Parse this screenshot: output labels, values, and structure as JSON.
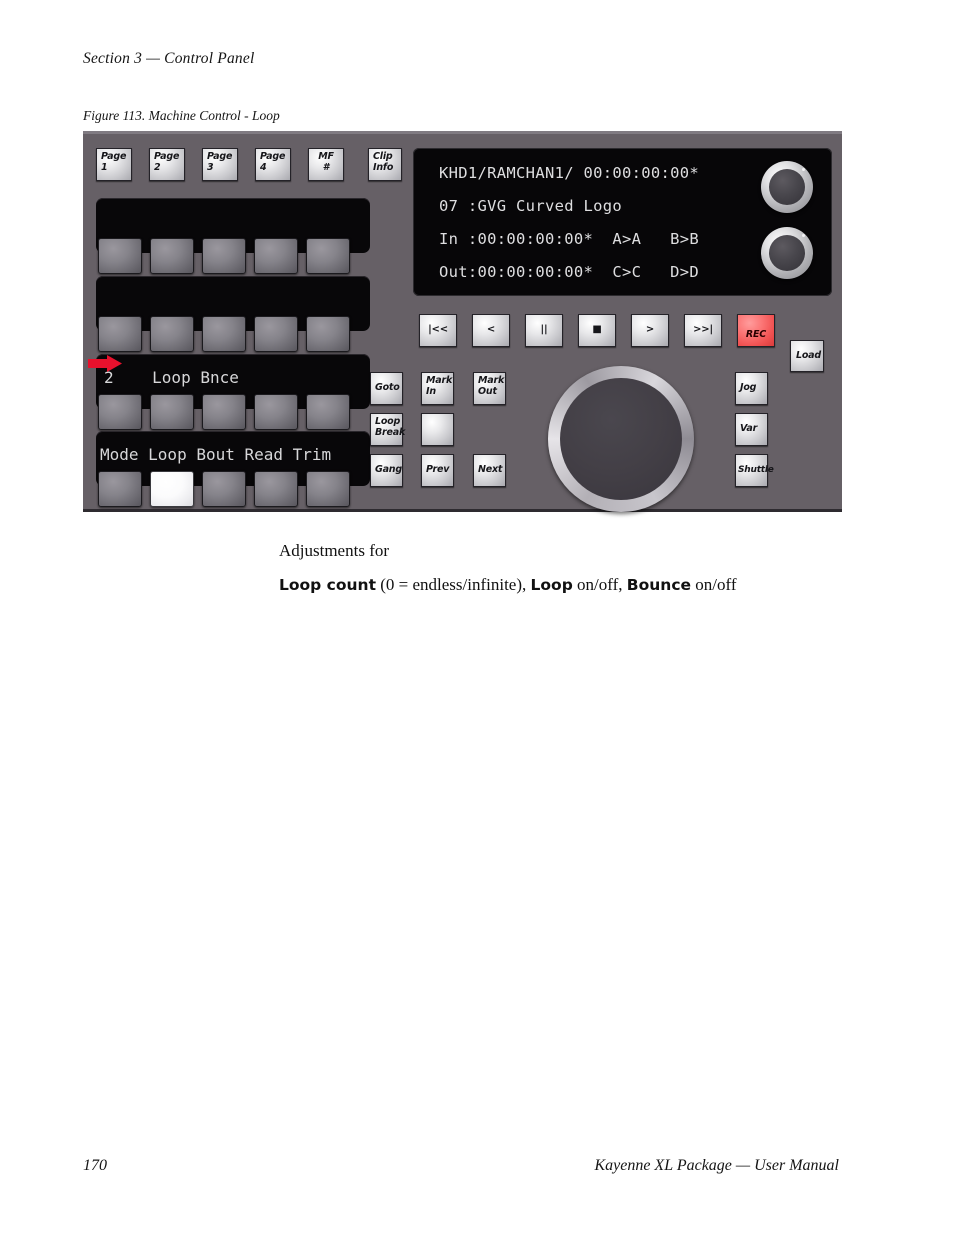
{
  "document": {
    "section_header": "Section 3 — Control Panel",
    "figure_caption": "Figure 113.  Machine Control - Loop",
    "body_intro": "Adjustments for",
    "body_detail": {
      "term1": "Loop count",
      "text1": " (0 = endless/infinite), ",
      "term2": "Loop",
      "text2": " on/off, ",
      "term3": "Bounce",
      "text3": " on/off"
    },
    "footer": {
      "page_number": "170",
      "title": "Kayenne XL Package  —  User Manual"
    }
  },
  "panel": {
    "page_buttons": [
      {
        "name": "page-1",
        "line1": "Page",
        "line2": "1",
        "lit": true
      },
      {
        "name": "page-2",
        "line1": "Page",
        "line2": "2",
        "lit": false
      },
      {
        "name": "page-3",
        "line1": "Page",
        "line2": "3",
        "lit": false
      },
      {
        "name": "page-4",
        "line1": "Page",
        "line2": "4",
        "lit": false
      },
      {
        "name": "mf-number",
        "line1": "MF",
        "line2": "#",
        "lit": false
      }
    ],
    "clip_info": {
      "line1": "Clip",
      "line2": "Info"
    },
    "softkey_strips": [
      {
        "name": "strip-1",
        "label": ""
      },
      {
        "name": "strip-2",
        "label": ""
      },
      {
        "name": "strip-3",
        "label": "2    Loop Bnce"
      },
      {
        "name": "strip-4",
        "label": "Mode Loop Bout Read Trim"
      }
    ],
    "softkey_rows": [
      {
        "row": 1,
        "lit_index": -1
      },
      {
        "row": 2,
        "lit_index": -1
      },
      {
        "row": 3,
        "lit_index": -1
      },
      {
        "row": 4,
        "lit_index": 1
      }
    ],
    "lcd": {
      "line1": "KHD1/RAMCHAN1/ 00:00:00:00*",
      "line2": "07 :GVG Curved Logo",
      "line3": "In :00:00:00:00*  A>A   B>B",
      "line4": "Out:00:00:00:00*  C>C   D>D"
    },
    "knobs": [
      {
        "name": "knob-upper"
      },
      {
        "name": "knob-lower"
      }
    ],
    "transport_buttons": [
      {
        "name": "rewind-to-start",
        "label": "|<<"
      },
      {
        "name": "rewind",
        "label": "<"
      },
      {
        "name": "pause",
        "label": "||"
      },
      {
        "name": "stop",
        "label": "■"
      },
      {
        "name": "play",
        "label": ">"
      },
      {
        "name": "fast-forward-to-end",
        "label": ">>|"
      },
      {
        "name": "record",
        "label": "REC",
        "style": "rec"
      }
    ],
    "load_button": {
      "label": "Load"
    },
    "command_buttons": [
      {
        "name": "goto",
        "line1": "Goto",
        "line2": ""
      },
      {
        "name": "mark-in",
        "line1": "Mark",
        "line2": "In"
      },
      {
        "name": "mark-out",
        "line1": "Mark",
        "line2": "Out"
      },
      {
        "name": "loop-break",
        "line1": "Loop",
        "line2": "Break"
      },
      {
        "name": "unlabeled",
        "line1": "",
        "line2": ""
      },
      {
        "name": "gang",
        "line1": "Gang",
        "line2": ""
      },
      {
        "name": "prev",
        "line1": "Prev",
        "line2": ""
      },
      {
        "name": "next",
        "line1": "Next",
        "line2": ""
      }
    ],
    "mode_buttons": [
      {
        "name": "jog",
        "label": "Jog"
      },
      {
        "name": "var",
        "label": "Var"
      },
      {
        "name": "shuttle",
        "label": "Shuttle"
      }
    ],
    "annotation": {
      "arrow_color": "#e8112d",
      "points_to": "2    Loop Bnce"
    }
  }
}
